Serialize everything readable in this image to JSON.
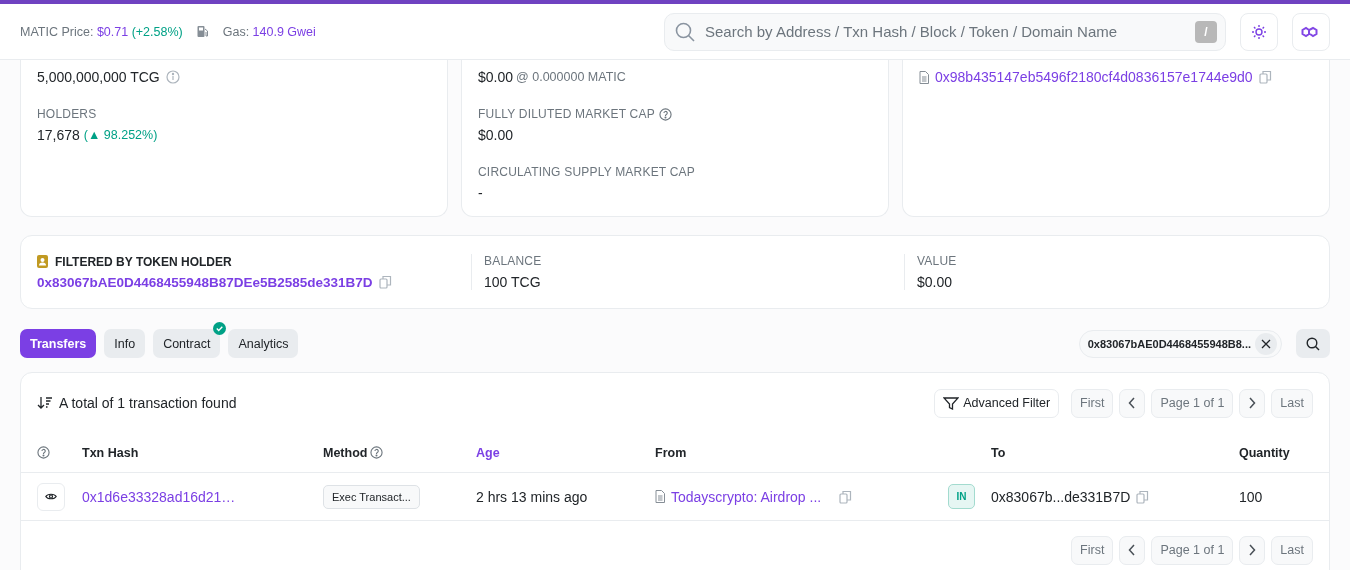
{
  "header": {
    "price_label": "MATIC Price:",
    "price": "$0.71",
    "change": "(+2.58%)",
    "gas_label": "Gas:",
    "gas": "140.9 Gwei",
    "search": {
      "placeholder": "Search by Address / Txn Hash / Block / Token / Domain Name",
      "shortcut": "/"
    }
  },
  "overview": {
    "max_supply": "5,000,000,000 TCG",
    "holders_label": "HOLDERS",
    "holders": "17,678",
    "holders_change": "(▲ 98.252%)"
  },
  "market": {
    "price": "$0.00",
    "price_matic": "@ 0.000000 MATIC",
    "fdmc_label": "FULLY DILUTED MARKET CAP",
    "fdmc": "$0.00",
    "csmc_label": "CIRCULATING SUPPLY MARKET CAP",
    "csmc": "-"
  },
  "other": {
    "contract": "0x98b435147eb5496f2180cf4d0836157e1744e9d0"
  },
  "filter": {
    "title": "FILTERED BY TOKEN HOLDER",
    "address": "0x83067bAE0D4468455948B87DEe5B2585de331B7D",
    "balance_label": "BALANCE",
    "balance": "100 TCG",
    "value_label": "VALUE",
    "value": "$0.00"
  },
  "tabs": [
    {
      "label": "Transfers",
      "selected": true,
      "verified": false
    },
    {
      "label": "Info",
      "selected": false,
      "verified": false
    },
    {
      "label": "Contract",
      "selected": false,
      "verified": true
    },
    {
      "label": "Analytics",
      "selected": false,
      "verified": false
    }
  ],
  "filter_chip": "0x83067bAE0D4468455948B8...",
  "table": {
    "summary": "A total of 1 transaction found",
    "advanced_filter": "Advanced Filter",
    "pagination": [
      {
        "first": "First",
        "page": "Page 1 of 1",
        "last": "Last"
      },
      {
        "first": "First",
        "page": "Page 1 of 1",
        "last": "Last"
      }
    ],
    "columns": [
      {
        "label": "Txn Hash",
        "help": false,
        "sorted": false
      },
      {
        "label": "Method",
        "help": true,
        "sorted": false
      },
      {
        "label": "Age",
        "help": false,
        "sorted": true
      },
      {
        "label": "From",
        "help": false,
        "sorted": false
      },
      {
        "label": "To",
        "help": false,
        "sorted": false
      },
      {
        "label": "Quantity",
        "help": false,
        "sorted": false
      }
    ],
    "rows": [
      {
        "hash": "0x1d6e33328ad16d21…",
        "method": "Exec Transact...",
        "age": "2 hrs 13 mins ago",
        "from": "Todayscrypto: Airdrop ...",
        "direction": "IN",
        "to": "0x83067b...de331B7D",
        "quantity": "100"
      }
    ]
  }
}
